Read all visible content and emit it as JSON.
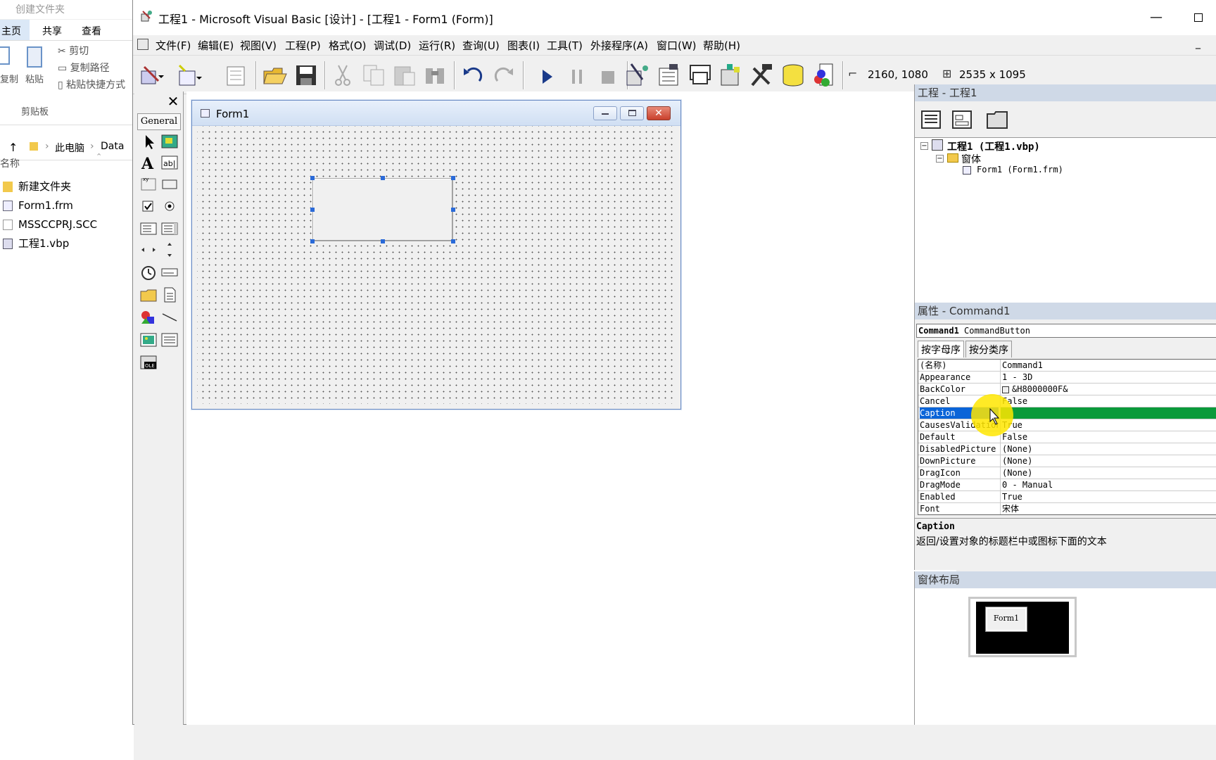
{
  "explorer": {
    "title": "创建文件夹",
    "tabs": [
      "主页",
      "共享",
      "查看"
    ],
    "ribbon": {
      "cut": "剪切",
      "copy_path": "复制路径",
      "paste_shortcut": "粘贴快捷方式",
      "copy": "复制",
      "paste": "粘贴",
      "clipboard_group": "剪贴板"
    },
    "address": [
      "此电脑",
      "Data"
    ],
    "column_name": "名称",
    "files": [
      {
        "name": "新建文件夹",
        "icon": "folder-icon"
      },
      {
        "name": "Form1.frm",
        "icon": "form-file-icon"
      },
      {
        "name": "MSSCCPRJ.SCC",
        "icon": "file-icon"
      },
      {
        "name": "工程1.vbp",
        "icon": "vb-project-icon"
      }
    ]
  },
  "window": {
    "title": "工程1 - Microsoft Visual Basic [设计] - [工程1 - Form1 (Form)]",
    "minimize": "—"
  },
  "menu": [
    "文件(F)",
    "编辑(E)",
    "视图(V)",
    "工程(P)",
    "格式(O)",
    "调试(D)",
    "运行(R)",
    "查询(U)",
    "图表(I)",
    "工具(T)",
    "外接程序(A)",
    "窗口(W)",
    "帮助(H)"
  ],
  "toolbar": {
    "position": "2160, 1080",
    "size": "2535 x 1095"
  },
  "toolbox": {
    "tab": "General",
    "close": "✕"
  },
  "designer": {
    "form_caption": "Form1",
    "close_glyph": "✕"
  },
  "project": {
    "header": "工程 - 工程1",
    "root": "工程1 (工程1.vbp)",
    "folder": "窗体",
    "form": "Form1 (Form1.frm)"
  },
  "properties": {
    "header": "属性 - Command1",
    "object_name": "Command1",
    "object_type": "CommandButton",
    "tab_alpha": "按字母序",
    "tab_category": "按分类序",
    "rows": [
      {
        "name": "(名称)",
        "value": "Command1"
      },
      {
        "name": "Appearance",
        "value": "1 - 3D"
      },
      {
        "name": "BackColor",
        "value": "&H8000000F&"
      },
      {
        "name": "Cancel",
        "value": "False"
      },
      {
        "name": "Caption",
        "value": ""
      },
      {
        "name": "CausesValidation",
        "value": "True"
      },
      {
        "name": "Default",
        "value": "False"
      },
      {
        "name": "DisabledPicture",
        "value": "(None)"
      },
      {
        "name": "DownPicture",
        "value": "(None)"
      },
      {
        "name": "DragIcon",
        "value": "(None)"
      },
      {
        "name": "DragMode",
        "value": "0 - Manual"
      },
      {
        "name": "Enabled",
        "value": "True"
      },
      {
        "name": "Font",
        "value": "宋体"
      }
    ],
    "selected": "Caption",
    "desc_title": "Caption",
    "desc_text": "返回/设置对象的标题栏中或图标下面的文本"
  },
  "layout": {
    "header": "窗体布局",
    "mini_form": "Form1"
  },
  "colors": {
    "selection": "#0a64d8",
    "value_highlight": "#0a9a3a",
    "panel_header": "#cfd9e7",
    "cursor_highlight": "#ffe600"
  }
}
